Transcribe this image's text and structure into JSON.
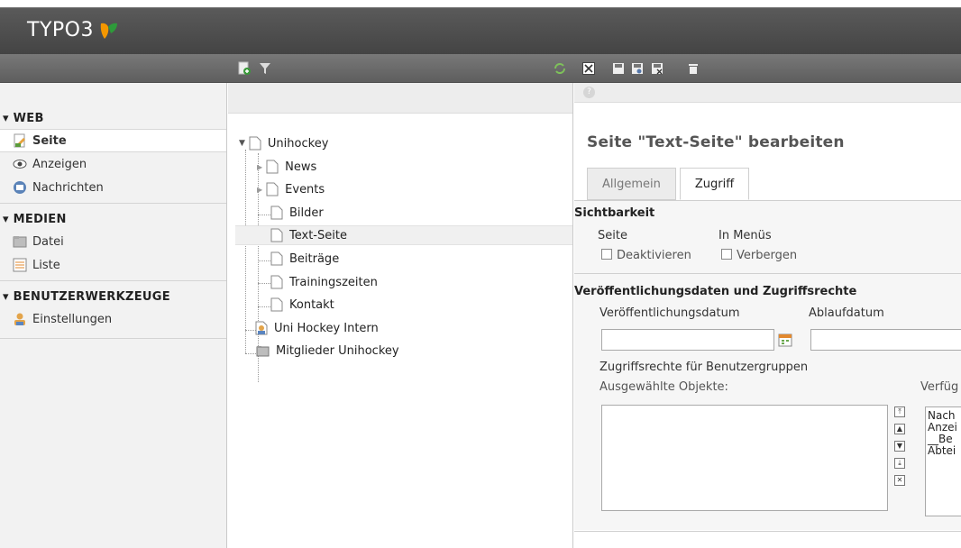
{
  "app": {
    "logo_text": "TYPO3"
  },
  "sidebar": {
    "groups": [
      {
        "title": "▾ WEB",
        "items": [
          {
            "label": "Seite",
            "icon": "page-edit-icon",
            "active": true
          },
          {
            "label": "Anzeigen",
            "icon": "eye-icon"
          },
          {
            "label": "Nachrichten",
            "icon": "news-icon"
          }
        ]
      },
      {
        "title": "▾ MEDIEN",
        "items": [
          {
            "label": "Datei",
            "icon": "folder-icon"
          },
          {
            "label": "Liste",
            "icon": "list-icon"
          }
        ]
      },
      {
        "title": "▾ BENUTZERWERKZEUGE",
        "items": [
          {
            "label": "Einstellungen",
            "icon": "user-settings-icon"
          }
        ]
      }
    ]
  },
  "tree": {
    "nodes": [
      {
        "label": "Unihockey",
        "icon": "page-icon"
      },
      {
        "label": "News",
        "icon": "page-icon"
      },
      {
        "label": "Events",
        "icon": "page-icon"
      },
      {
        "label": "Bilder",
        "icon": "page-icon"
      },
      {
        "label": "Text-Seite",
        "icon": "page-icon",
        "selected": true
      },
      {
        "label": "Beiträge",
        "icon": "page-icon"
      },
      {
        "label": "Trainingszeiten",
        "icon": "page-icon"
      },
      {
        "label": "Kontakt",
        "icon": "page-icon"
      },
      {
        "label": "Uni Hockey Intern",
        "icon": "user-page-icon"
      },
      {
        "label": "Mitglieder Unihockey",
        "icon": "folder-icon"
      }
    ]
  },
  "editor": {
    "title": "Seite \"Text-Seite\" bearbeiten",
    "tabs": [
      {
        "label": "Allgemein"
      },
      {
        "label": "Zugriff",
        "active": true
      }
    ],
    "visibility": {
      "section_title": "Sichtbarkeit",
      "col1_label": "Seite",
      "col2_label": "In Menüs",
      "check1": "Deaktivieren",
      "check2": "Verbergen"
    },
    "publish": {
      "section_title": "Veröffentlichungsdaten und Zugriffsrechte",
      "start_label": "Veröffentlichungsdatum",
      "end_label": "Ablaufdatum",
      "access_label": "Zugriffsrechte für Benutzergruppen",
      "selected_label": "Ausgewählte Objekte:",
      "available_label": "Verfüg",
      "available_items": [
        "Nach",
        "Anzei",
        "__Be",
        "Abtei"
      ]
    }
  },
  "colors": {
    "topbar": "#4a4a4a",
    "toolbar": "#6b6b6b",
    "logo_accent": "#f49700"
  }
}
